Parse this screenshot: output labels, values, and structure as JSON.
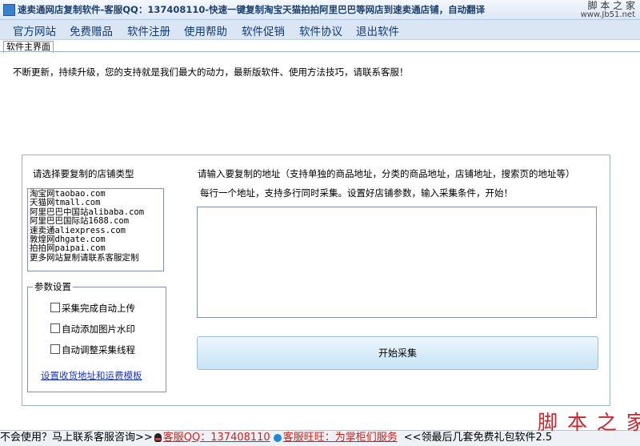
{
  "window": {
    "title": "速卖通网店复制软件-客服QQ：137408110-快速一键复制淘宝天猫拍拍阿里巴巴等网店到速卖通店铺，自动翻译",
    "watermark_top_line1": "脚 本 之 家",
    "watermark_top_line2": "www.Jb51.net",
    "app_icon": "app-icon"
  },
  "menu": [
    "官方网站",
    "免费赠品",
    "软件注册",
    "使用帮助",
    "软件促销",
    "软件协议",
    "退出软件"
  ],
  "tab": {
    "label": "软件主界面"
  },
  "notice": "不断更新，持续升级，您的支持就是我们最大的动力，最新版软件、使用方法技巧，请联系客服！",
  "store_section": {
    "label": "请选择要复制的店铺类型",
    "items": [
      "淘宝网taobao.com",
      "天猫网tmall.com",
      "阿里巴巴中国站alibaba.com",
      "阿里巴巴国际站1688.com",
      "速卖通aliexpress.com",
      "敦煌网dhgate.com",
      "拍拍网paipai.com",
      "更多网站复制请联系客服定制"
    ]
  },
  "params": {
    "legend": "参数设置",
    "options": [
      {
        "label": "采集完成自动上传",
        "checked": false
      },
      {
        "label": "自动添加图片水印",
        "checked": false
      },
      {
        "label": "自动调整采集线程",
        "checked": false
      }
    ],
    "link": "设置收货地址和运费模板"
  },
  "url_section": {
    "label": "请输入要复制的地址（支持单独的商品地址，分类的商品地址，店铺地址，搜索页的地址等）",
    "hint": "每行一个地址，支持多行同时采集。设置好店铺参数，输入采集条件，开始！",
    "value": ""
  },
  "start_button": "开始采集",
  "status_bar": {
    "prefix": "不会使用？马上联系客服咨询>>",
    "qq": "客服QQ：137408110",
    "wangwang": "客服旺旺：为掌柜们服务",
    "suffix": "<<领最后几套免费礼包软件2.5"
  },
  "watermark_bottom": "脚 本 之 家"
}
